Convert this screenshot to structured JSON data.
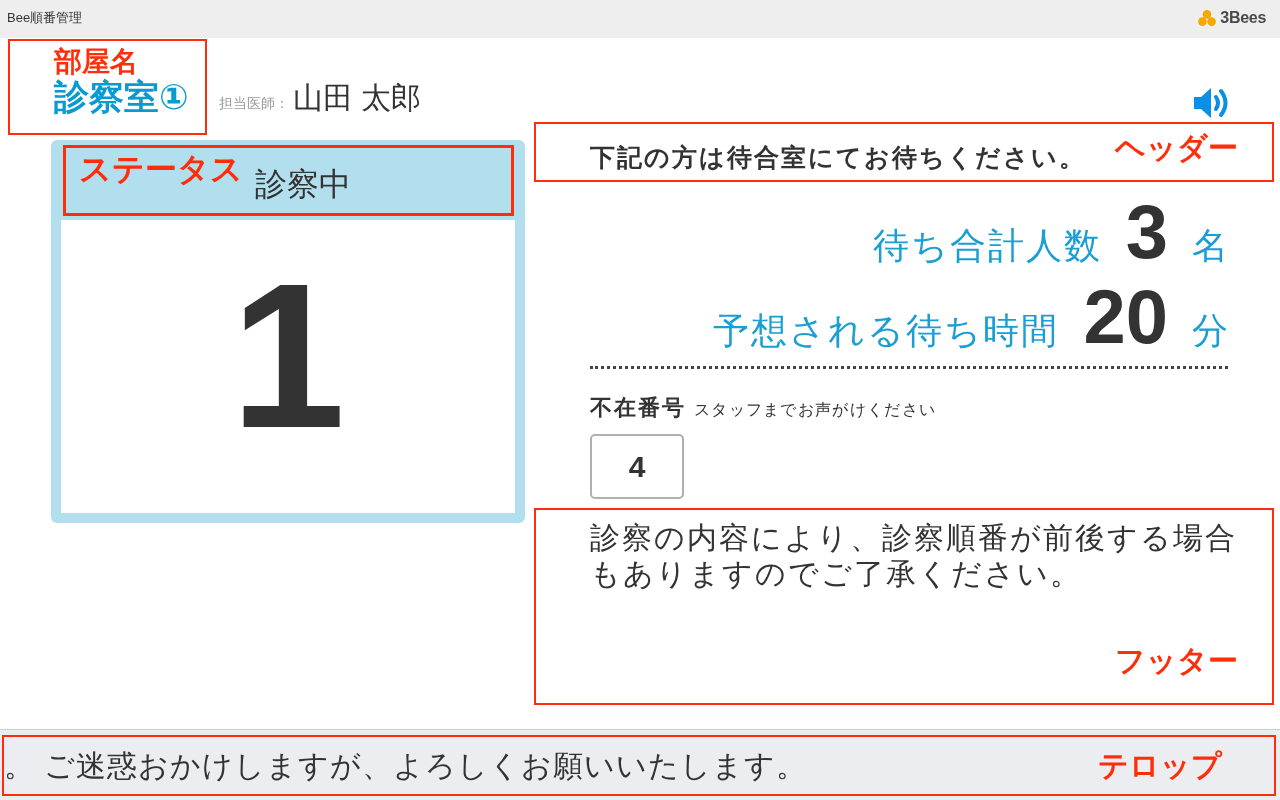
{
  "title_bar": {
    "title": "Bee順番管理",
    "logo_text": "3Bees"
  },
  "room": {
    "annotation": "部屋名",
    "name": "診察室①",
    "doctor_label": "担当医師：",
    "doctor_name": "山田 太郎"
  },
  "status_card": {
    "annotation": "ステータス",
    "status": "診察中",
    "current_number": "1"
  },
  "header": {
    "annotation": "ヘッダー",
    "message": "下記の方は待合室にてお待ちください。"
  },
  "summary": [
    {
      "label": "待ち合計人数",
      "value": "3",
      "unit": "名"
    },
    {
      "label": "予想される待ち時間",
      "value": "20",
      "unit": "分"
    }
  ],
  "absent": {
    "label": "不在番号",
    "note": "スタッフまでお声がけください",
    "numbers": [
      "4"
    ]
  },
  "footer": {
    "annotation": "フッター",
    "message": "診察の内容により、診察順番が前後する場合もありますのでご了承ください。"
  },
  "ticker": {
    "annotation": "テロップ",
    "text": "。 ご迷惑おかけしますが、よろしくお願いいたします。"
  }
}
